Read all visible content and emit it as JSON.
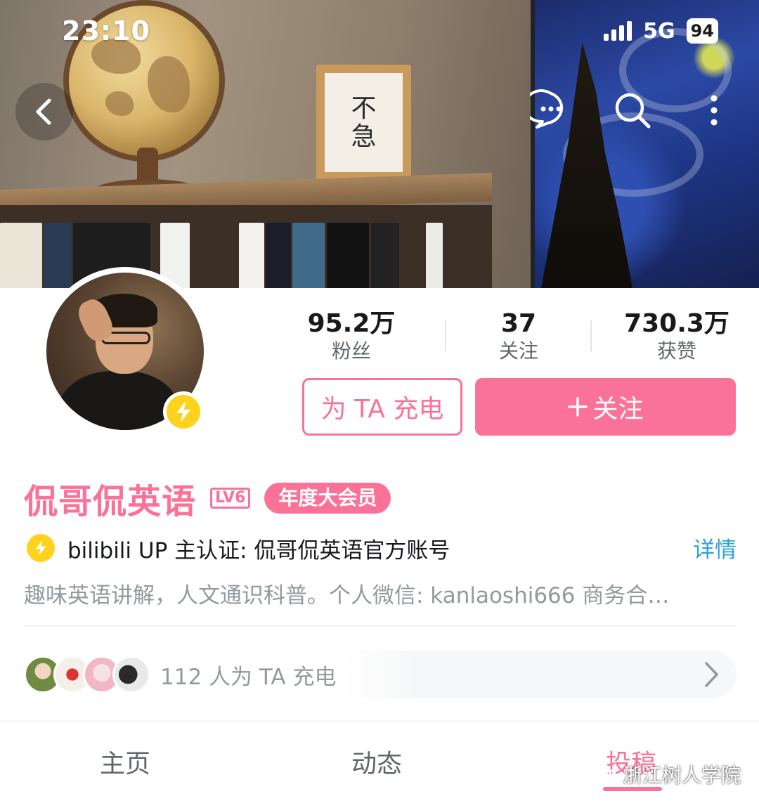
{
  "status_bar": {
    "time": "23:10",
    "network": "5G",
    "battery": "94"
  },
  "profile": {
    "stats": [
      {
        "value": "95.2万",
        "label": "粉丝"
      },
      {
        "value": "37",
        "label": "关注"
      },
      {
        "value": "730.3万",
        "label": "获赞"
      }
    ],
    "charge_button": "为 TA 充电",
    "follow_button": "关注",
    "username": "侃哥侃英语",
    "level": "LV6",
    "vip_badge": "年度大会员",
    "certification": "bilibili UP 主认证: 侃哥侃英语官方账号",
    "detail_link": "详情",
    "bio": "趣味英语讲解，人文通识科普。个人微信: kanlaoshi666 商务合…",
    "charge_row": {
      "text": "112 人为 TA 充电"
    }
  },
  "banner": {
    "frame_text": [
      "不",
      "急"
    ]
  },
  "tabs": [
    {
      "label": "主页",
      "active": false
    },
    {
      "label": "动态",
      "active": false
    },
    {
      "label": "投稿",
      "active": true
    }
  ],
  "watermark": "浙江树人学院",
  "colors": {
    "accent": "#fb7299",
    "link": "#2fa0d8",
    "charge": "#ffd21e"
  }
}
